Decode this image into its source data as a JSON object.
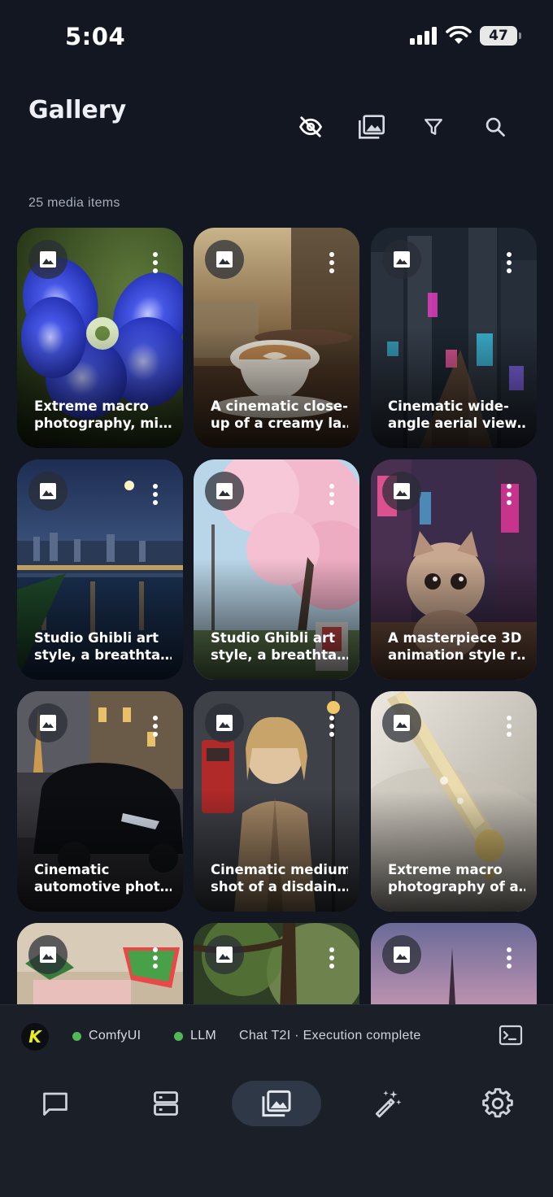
{
  "status_bar": {
    "time": "5:04",
    "battery": "47"
  },
  "header": {
    "title": "Gallery",
    "actions": [
      "eye-off-icon",
      "gallery-icon",
      "filter-icon",
      "search-icon"
    ]
  },
  "gallery": {
    "count_label": "25 media items",
    "items": [
      {
        "caption": "Extreme macro\nphotography, mi…"
      },
      {
        "caption": "A cinematic close-\nup of a creamy la…"
      },
      {
        "caption": "Cinematic wide-\nangle aerial view…"
      },
      {
        "caption": "Studio Ghibli art\nstyle, a breathta…"
      },
      {
        "caption": "Studio Ghibli art\nstyle, a breathta…"
      },
      {
        "caption": "A masterpiece 3D\nanimation style r…"
      },
      {
        "caption": "Cinematic\nautomotive phot…"
      },
      {
        "caption": "Cinematic medium\nshot of a disdain…"
      },
      {
        "caption": "Extreme macro\nphotography of a…"
      },
      {
        "caption": ""
      },
      {
        "caption": ""
      },
      {
        "caption": ""
      }
    ]
  },
  "status_strip": {
    "logo": "K",
    "services": [
      {
        "name": "ComfyUI",
        "state_color": "#52b855"
      },
      {
        "name": "LLM",
        "state_color": "#52b855"
      }
    ],
    "message": "Chat T2I · Execution complete"
  },
  "bottom_nav": {
    "items": [
      "chat-icon",
      "servers-icon",
      "gallery-icon",
      "magic-wand-icon",
      "settings-icon"
    ],
    "active": "gallery-icon"
  }
}
